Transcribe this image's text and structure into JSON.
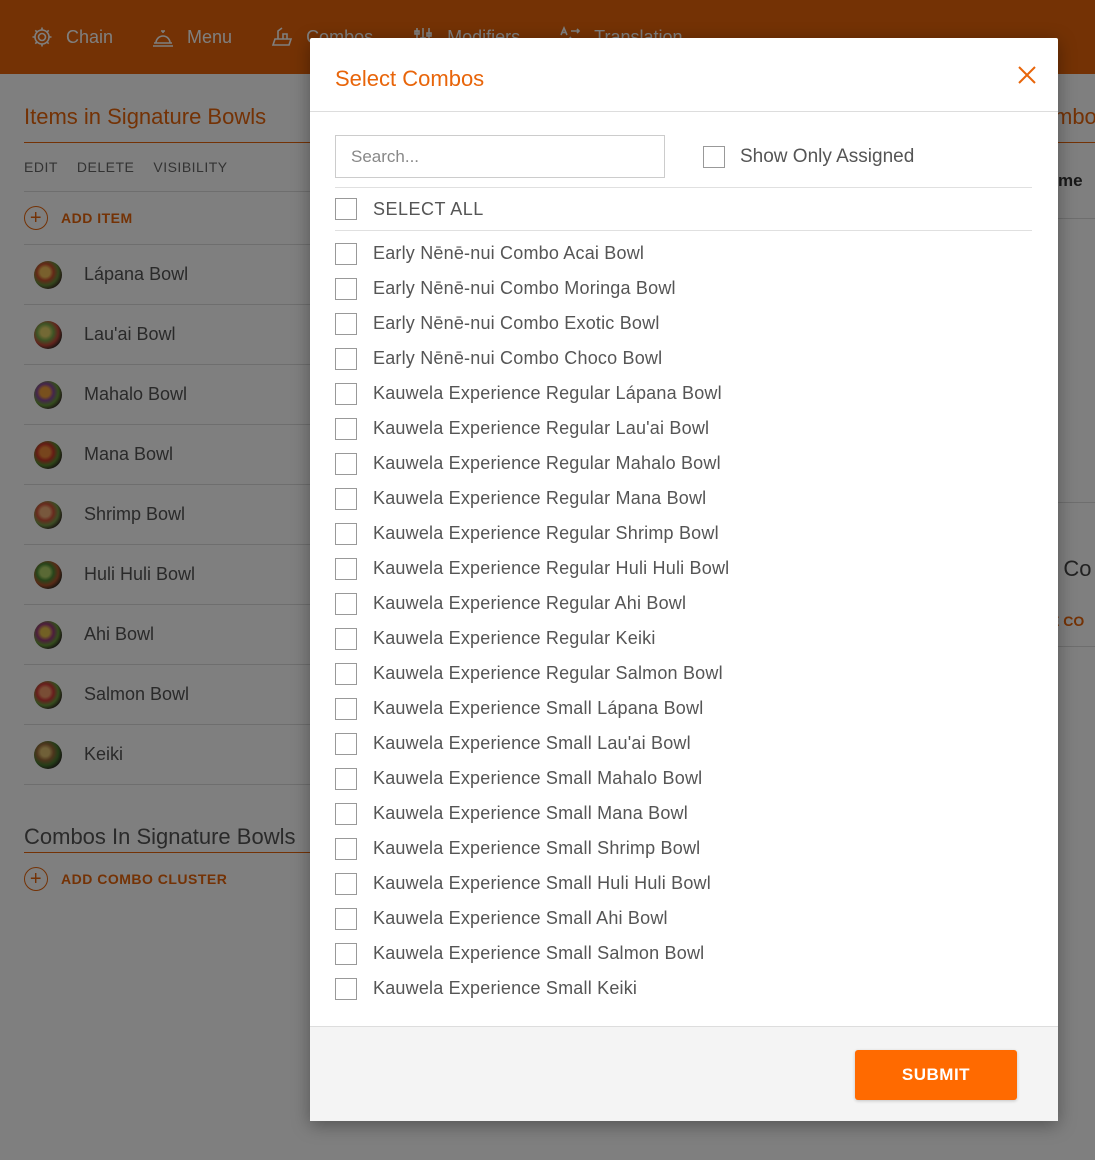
{
  "nav": {
    "items": [
      {
        "label": "Chain",
        "icon": "gear-icon"
      },
      {
        "label": "Menu",
        "icon": "cloche-icon"
      },
      {
        "label": "Combos",
        "icon": "combo-icon"
      },
      {
        "label": "Modifiers",
        "icon": "sliders-icon"
      },
      {
        "label": "Translation",
        "icon": "translate-icon"
      }
    ]
  },
  "left_panel": {
    "title": "Items in Signature Bowls",
    "toolbar": [
      "EDIT",
      "DELETE",
      "VISIBILITY"
    ],
    "add_item_label": "ADD ITEM",
    "items": [
      {
        "name": "Lápana Bowl"
      },
      {
        "name": "Lau'ai Bowl"
      },
      {
        "name": "Mahalo Bowl"
      },
      {
        "name": "Mana Bowl"
      },
      {
        "name": "Shrimp Bowl"
      },
      {
        "name": "Huli Huli Bowl"
      },
      {
        "name": "Ahi Bowl"
      },
      {
        "name": "Salmon Bowl"
      },
      {
        "name": "Keiki"
      }
    ],
    "combos_title": "Combos In Signature Bowls",
    "add_combo_label": "ADD COMBO CLUSTER"
  },
  "right_peek": {
    "title_fragment": "mbo",
    "name_fragment": "me",
    "title2_fragment": "d Co",
    "add_fragment": "E CO"
  },
  "modal": {
    "title": "Select Combos",
    "search_placeholder": "Search...",
    "show_only_assigned_label": "Show Only Assigned",
    "select_all_label": "SELECT ALL",
    "combos": [
      "Early Nēnē-nui Combo Acai Bowl",
      "Early Nēnē-nui Combo Moringa Bowl",
      "Early Nēnē-nui Combo Exotic Bowl",
      "Early Nēnē-nui Combo Choco Bowl",
      "Kauwela Experience Regular Lápana Bowl",
      "Kauwela Experience Regular Lau'ai Bowl",
      "Kauwela Experience Regular Mahalo Bowl",
      "Kauwela Experience Regular Mana Bowl",
      "Kauwela Experience Regular Shrimp Bowl",
      "Kauwela Experience Regular Huli Huli Bowl",
      "Kauwela Experience Regular Ahi Bowl",
      "Kauwela Experience Regular Keiki",
      "Kauwela Experience Regular Salmon Bowl",
      "Kauwela Experience Small Lápana Bowl",
      "Kauwela Experience Small Lau'ai Bowl",
      "Kauwela Experience Small Mahalo Bowl",
      "Kauwela Experience Small Mana Bowl",
      "Kauwela Experience Small Shrimp Bowl",
      "Kauwela Experience Small Huli Huli Bowl",
      "Kauwela Experience Small Ahi Bowl",
      "Kauwela Experience Small Salmon Bowl",
      "Kauwela Experience Small Keiki"
    ],
    "submit_label": "SUBMIT"
  },
  "colors": {
    "accent": "#e8650a",
    "submit": "#ff6a00"
  }
}
